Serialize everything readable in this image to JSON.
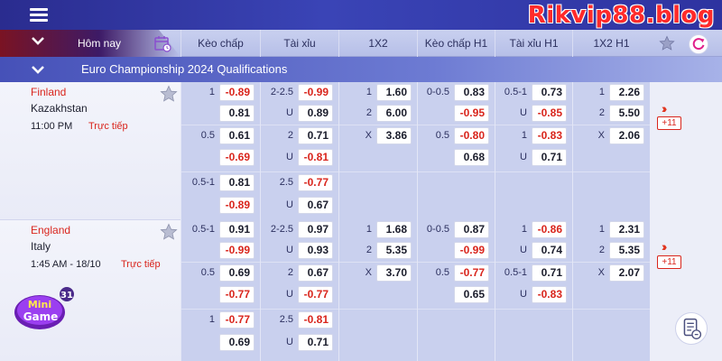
{
  "brand": "Rikvip88.blog",
  "header": {
    "today": "Hôm nay",
    "columns": [
      "Kèo chấp",
      "Tài xỉu",
      "1X2",
      "Kèo chấp H1",
      "Tài xỉu H1",
      "1X2 H1"
    ]
  },
  "league": "Euro Championship 2024 Qualifications",
  "matches": [
    {
      "home": "Finland",
      "away": "Kazakhstan",
      "time": "11:00 PM",
      "live": "Trực tiếp",
      "more": "+11",
      "handicap": [
        {
          "h": "1",
          "o1": "-0.89",
          "o2": "0.81"
        },
        {
          "h": "0.5",
          "o1": "0.61",
          "o2": "-0.69"
        },
        {
          "h": "0.5-1",
          "o1": "0.81",
          "o2": "-0.89"
        }
      ],
      "ou": [
        {
          "h": "2-2.5",
          "o1": "-0.99",
          "o2": "0.89"
        },
        {
          "h": "2",
          "o1": "0.71",
          "o2": "-0.81"
        },
        {
          "h": "2.5",
          "o1": "-0.77",
          "o2": "0.67"
        }
      ],
      "x12": [
        {
          "h": "1",
          "o": "1.60"
        },
        {
          "h": "2",
          "o": "6.00"
        },
        {
          "h": "X",
          "o": "3.86"
        }
      ],
      "handicap_h1": [
        {
          "h": "0-0.5",
          "o1": "0.83",
          "o2": "-0.95"
        },
        {
          "h": "0.5",
          "o1": "-0.80",
          "o2": "0.68"
        }
      ],
      "ou_h1": [
        {
          "h": "0.5-1",
          "o1": "0.73",
          "o2": "-0.85"
        },
        {
          "h": "1",
          "o1": "-0.83",
          "o2": "0.71"
        }
      ],
      "x12_h1": [
        {
          "h": "1",
          "o": "2.26"
        },
        {
          "h": "2",
          "o": "5.50"
        },
        {
          "h": "X",
          "o": "2.06"
        }
      ]
    },
    {
      "home": "England",
      "away": "Italy",
      "time": "1:45 AM - 18/10",
      "live": "Trực tiếp",
      "more": "+11",
      "handicap": [
        {
          "h": "0.5-1",
          "o1": "0.91",
          "o2": "-0.99"
        },
        {
          "h": "0.5",
          "o1": "0.69",
          "o2": "-0.77"
        },
        {
          "h": "1",
          "o1": "-0.77",
          "o2": "0.69"
        }
      ],
      "ou": [
        {
          "h": "2-2.5",
          "o1": "0.97",
          "o2": "0.93"
        },
        {
          "h": "2",
          "o1": "0.67",
          "o2": "-0.77"
        },
        {
          "h": "2.5",
          "o1": "-0.81",
          "o2": "0.71"
        }
      ],
      "x12": [
        {
          "h": "1",
          "o": "1.68"
        },
        {
          "h": "2",
          "o": "5.35"
        },
        {
          "h": "X",
          "o": "3.70"
        }
      ],
      "handicap_h1": [
        {
          "h": "0-0.5",
          "o1": "0.87",
          "o2": "-0.99"
        },
        {
          "h": "0.5",
          "o1": "-0.77",
          "o2": "0.65"
        }
      ],
      "ou_h1": [
        {
          "h": "1",
          "o1": "-0.86",
          "o2": "0.74"
        },
        {
          "h": "0.5-1",
          "o1": "0.71",
          "o2": "-0.83"
        }
      ],
      "x12_h1": [
        {
          "h": "1",
          "o": "2.31"
        },
        {
          "h": "2",
          "o": "5.35"
        },
        {
          "h": "X",
          "o": "2.07"
        }
      ]
    }
  ],
  "under_label": "U",
  "minigame": {
    "label_top": "Mini",
    "label_bottom": "Game",
    "count": "31"
  },
  "colors": {
    "accent_red": "#d9251c",
    "header_blue": "#3a44b6",
    "league_blue": "#4651b8"
  },
  "icons": [
    "menu-icon",
    "chevron-down-icon",
    "calendar-icon",
    "star-icon",
    "refresh-icon",
    "double-chevron-right-icon",
    "bet-slip-icon"
  ]
}
